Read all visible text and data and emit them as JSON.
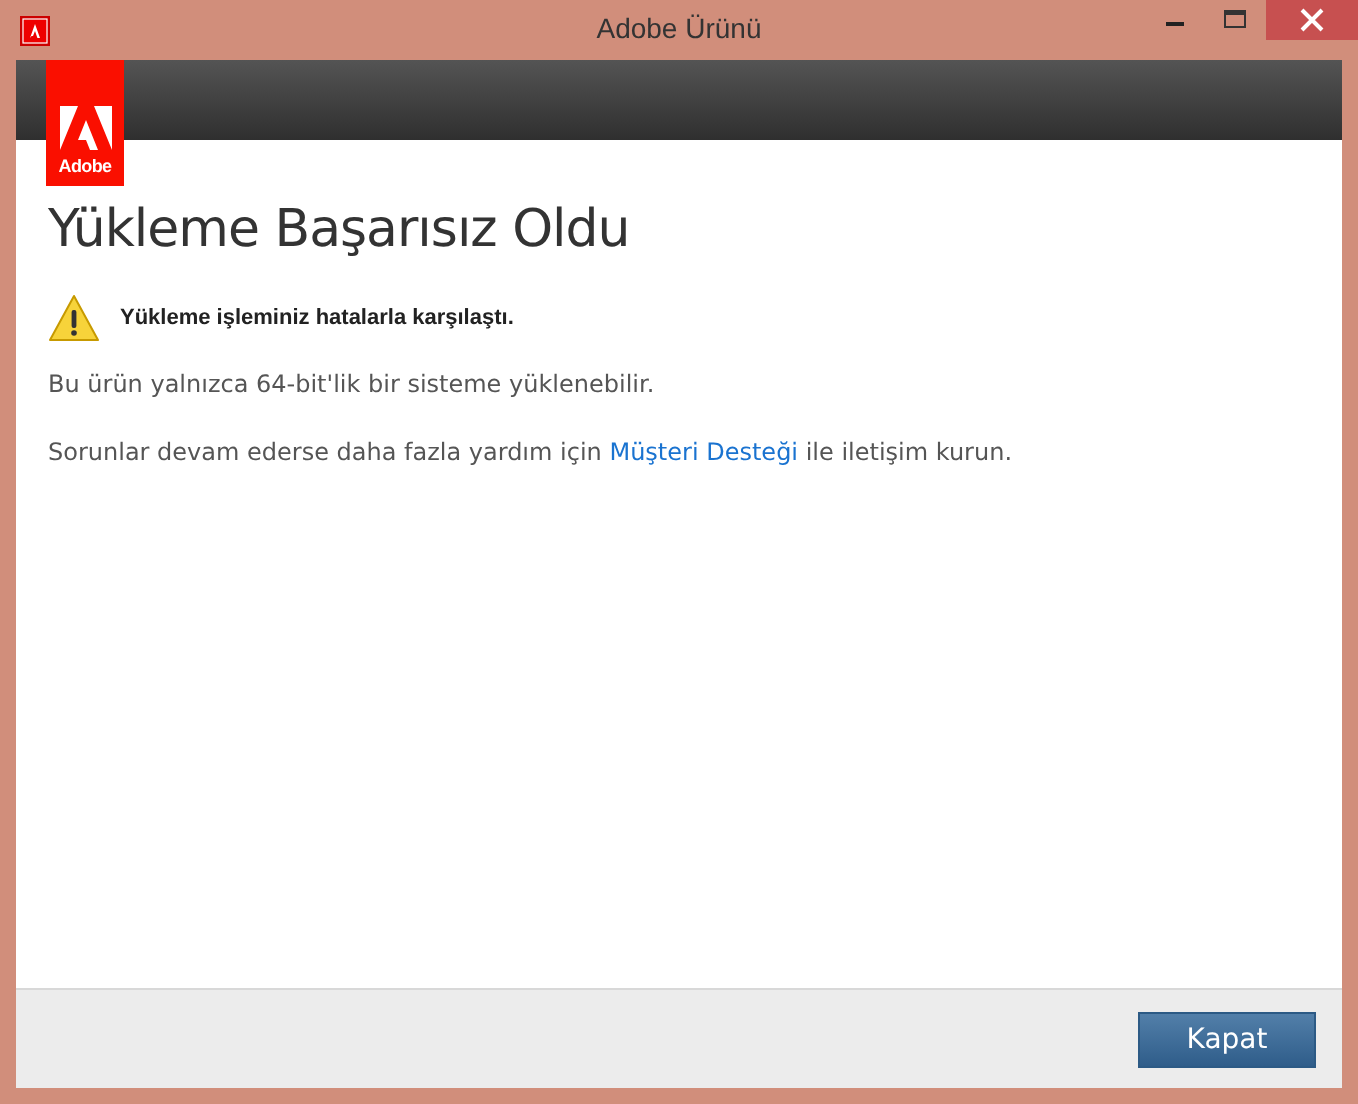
{
  "window": {
    "title": "Adobe Ürünü"
  },
  "logo": {
    "text": "Adobe"
  },
  "heading": "Yükleme Başarısız Oldu",
  "warning": "Yükleme işleminiz hatalarla karşılaştı.",
  "message": "Bu ürün yalnızca 64-bit'lik bir sisteme yüklenebilir.",
  "support": {
    "before": "Sorunlar devam ederse daha fazla yardım için ",
    "link": "Müşteri Desteği",
    "after": " ile iletişim kurun."
  },
  "buttons": [
    "Kapat"
  ]
}
